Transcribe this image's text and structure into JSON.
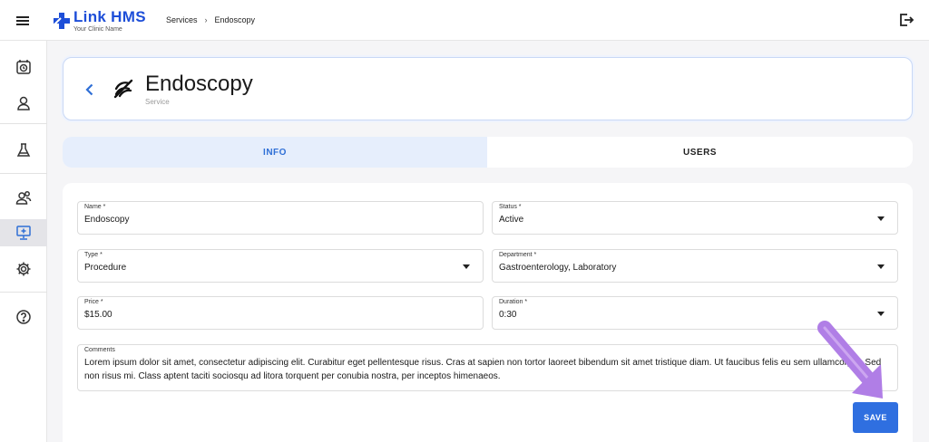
{
  "app": {
    "logo_name": "Link HMS",
    "logo_subtitle": "Your Clinic Name",
    "brand_color": "#1d4ed8",
    "accent_color": "#2f6fe0"
  },
  "breadcrumb": {
    "items": [
      "Services",
      "Endoscopy"
    ],
    "separator": "›"
  },
  "sidebar": {
    "items": [
      {
        "icon": "calendar-clock-icon"
      },
      {
        "icon": "person-icon"
      },
      {
        "icon": "flask-icon"
      },
      {
        "icon": "users-group-icon"
      },
      {
        "icon": "monitor-service-icon",
        "active": true
      },
      {
        "icon": "gear-icon"
      },
      {
        "icon": "help-icon"
      }
    ]
  },
  "header": {
    "title": "Endoscopy",
    "subtitle": "Service"
  },
  "tabs": [
    {
      "label": "INFO",
      "active": true
    },
    {
      "label": "USERS",
      "active": false
    }
  ],
  "form": {
    "name": {
      "label": "Name *",
      "value": "Endoscopy"
    },
    "status": {
      "label": "Status *",
      "value": "Active"
    },
    "type": {
      "label": "Type *",
      "value": "Procedure"
    },
    "department": {
      "label": "Department *",
      "value": "Gastroenterology, Laboratory"
    },
    "price": {
      "label": "Price *",
      "value": "$15.00"
    },
    "duration": {
      "label": "Duration *",
      "value": "0:30"
    },
    "comments": {
      "label": "Comments",
      "value": "Lorem ipsum dolor sit amet, consectetur adipiscing elit. Curabitur eget pellentesque risus. Cras at sapien non tortor laoreet bibendum sit amet tristique diam. Ut faucibus felis eu sem ullamcorper. Sed non risus mi. Class aptent taciti sociosqu ad litora torquent per conubia nostra, per inceptos himenaeos."
    }
  },
  "actions": {
    "save_label": "SAVE"
  }
}
